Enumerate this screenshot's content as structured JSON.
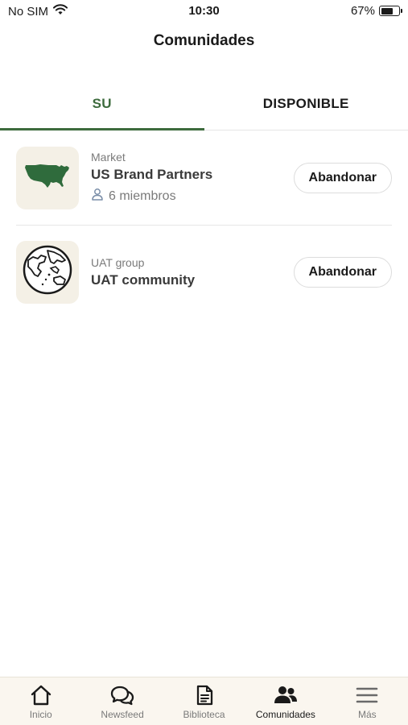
{
  "status_bar": {
    "carrier": "No SIM",
    "time": "10:30",
    "battery": "67%",
    "battery_level": 0.67
  },
  "header": {
    "title": "Comunidades"
  },
  "tabs": [
    {
      "label": "SU",
      "active": true
    },
    {
      "label": "DISPONIBLE",
      "active": false
    }
  ],
  "communities": [
    {
      "type": "Market",
      "name": "US Brand Partners",
      "members": "6 miembros",
      "icon": "us-map-icon",
      "action": "Abandonar"
    },
    {
      "type": "UAT group",
      "name": "UAT community",
      "members": "",
      "icon": "globe-icon",
      "action": "Abandonar"
    }
  ],
  "bottom_nav": [
    {
      "label": "Inicio",
      "icon": "home-icon",
      "active": false
    },
    {
      "label": "Newsfeed",
      "icon": "chat-bubbles-icon",
      "active": false
    },
    {
      "label": "Biblioteca",
      "icon": "document-icon",
      "active": false
    },
    {
      "label": "Comunidades",
      "icon": "people-icon",
      "active": true
    },
    {
      "label": "Más",
      "icon": "menu-icon",
      "active": false
    }
  ],
  "colors": {
    "accent": "#3d6b3d",
    "thumb_bg": "#f4f0e6",
    "nav_bg": "#faf6ef"
  }
}
